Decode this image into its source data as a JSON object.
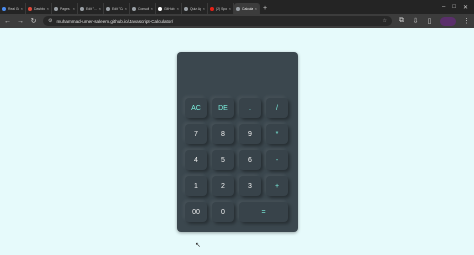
{
  "tabs": [
    {
      "label": "Real Go…",
      "color": "#4a8cf0",
      "active": false
    },
    {
      "label": "Dashboard…",
      "color": "#e24a3b",
      "active": false
    },
    {
      "label": "Pages …",
      "color": "#9aa0a6",
      "active": false
    },
    {
      "label": "Edit \"…\"",
      "color": "#9aa0a6",
      "active": false
    },
    {
      "label": "Edit \"Ca…",
      "color": "#9aa0a6",
      "active": false
    },
    {
      "label": "Consult …",
      "color": "#9aa0a6",
      "active": false
    },
    {
      "label": "GitHub…",
      "color": "#ffffff",
      "active": false
    },
    {
      "label": "Quiz App",
      "color": "#9aa0a6",
      "active": false
    },
    {
      "label": "(2) Spo…",
      "color": "#e62117",
      "active": false
    },
    {
      "label": "Calculat…",
      "color": "#9aa0a6",
      "active": true
    }
  ],
  "address": {
    "url": "muhammad-umer-saleem.github.io/Javascript-Calculator/"
  },
  "calculator": {
    "display": "",
    "keys": [
      {
        "name": "ac-button",
        "label": "AC",
        "kind": "fn"
      },
      {
        "name": "delete-button",
        "label": "DE",
        "kind": "fn"
      },
      {
        "name": "decimal-button",
        "label": ".",
        "kind": "fn"
      },
      {
        "name": "divide-button",
        "label": "/",
        "kind": "op"
      },
      {
        "name": "seven-button",
        "label": "7",
        "kind": "num"
      },
      {
        "name": "eight-button",
        "label": "8",
        "kind": "num"
      },
      {
        "name": "nine-button",
        "label": "9",
        "kind": "num"
      },
      {
        "name": "multiply-button",
        "label": "*",
        "kind": "op"
      },
      {
        "name": "four-button",
        "label": "4",
        "kind": "num"
      },
      {
        "name": "five-button",
        "label": "5",
        "kind": "num"
      },
      {
        "name": "six-button",
        "label": "6",
        "kind": "num"
      },
      {
        "name": "minus-button",
        "label": "-",
        "kind": "op"
      },
      {
        "name": "one-button",
        "label": "1",
        "kind": "num"
      },
      {
        "name": "two-button",
        "label": "2",
        "kind": "num"
      },
      {
        "name": "three-button",
        "label": "3",
        "kind": "num"
      },
      {
        "name": "plus-button",
        "label": "+",
        "kind": "op"
      },
      {
        "name": "double-zero-button",
        "label": "00",
        "kind": "num"
      },
      {
        "name": "zero-button",
        "label": "0",
        "kind": "num"
      },
      {
        "name": "equals-button",
        "label": "=",
        "kind": "op"
      }
    ]
  }
}
